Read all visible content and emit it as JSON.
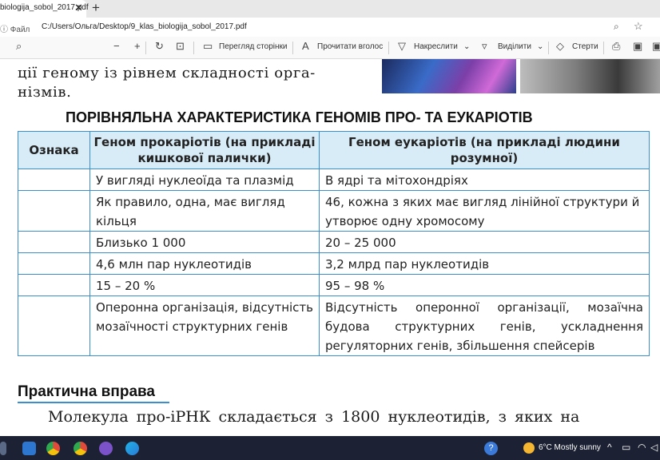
{
  "browser": {
    "tab_title": "biologija_sobol_2017.pdf",
    "tab_close_glyph": "✕",
    "new_tab_glyph": "+",
    "address_label": "ⓘ Файл",
    "address_path": "C:/Users/Ольга/Desktop/9_klas_biologija_sobol_2017.pdf"
  },
  "pdf_toolbar": {
    "page_view": "Перегляд сторінки",
    "read_aloud": "Прочитати вголос",
    "draw": "Накреслити",
    "highlight": "Виділити",
    "erase": "Стерти"
  },
  "document": {
    "intro_line1": "ції геному із рівнем складності орга-",
    "intro_line2": "нізмів.",
    "table_title": "ПОРІВНЯЛЬНА ХАРАКТЕРИСТИКА ГЕНОМІВ ПРО- ТА ЕУКАРІОТІВ",
    "headers": [
      "Ознака",
      "Геном прокаріотів (на прикладі кишкової палички)",
      "Геном еукаріотів (на прикладі людини розумної)"
    ],
    "rows": [
      [
        "",
        "У вигляді нуклеоїда та плазмід",
        "В ядрі та мітохондріях"
      ],
      [
        "",
        "Як правило, одна, має вигляд кільця",
        "46, кожна з яких має вигляд лінійної структури й утворює одну хромосому"
      ],
      [
        "",
        "Близько 1 000",
        "20 – 25 000"
      ],
      [
        "",
        "4,6 млн пар нуклеотидів",
        "3,2 млрд пар нуклеотидів"
      ],
      [
        "",
        "15 – 20 %",
        "95 – 98 %"
      ],
      [
        "",
        "Оперонна організація, відсутність мозаїчності структурних генів",
        "Відсутність оперонної організації, мозаїчна будова структурних генів, ускладнення регуляторних генів, збільшення спейсерів"
      ]
    ],
    "practice_heading": "Практична вправа",
    "practice_text": "Молекула про-іРНК складається з 1800 нуклеотидів, з яких на"
  },
  "taskbar": {
    "weather": "6°C  Mostly sunny",
    "help_glyph": "?"
  },
  "colors": {
    "table_border": "#3b8fcf",
    "table_header_bg": "#d8ecf8",
    "taskbar_bg": "#1c2233"
  }
}
